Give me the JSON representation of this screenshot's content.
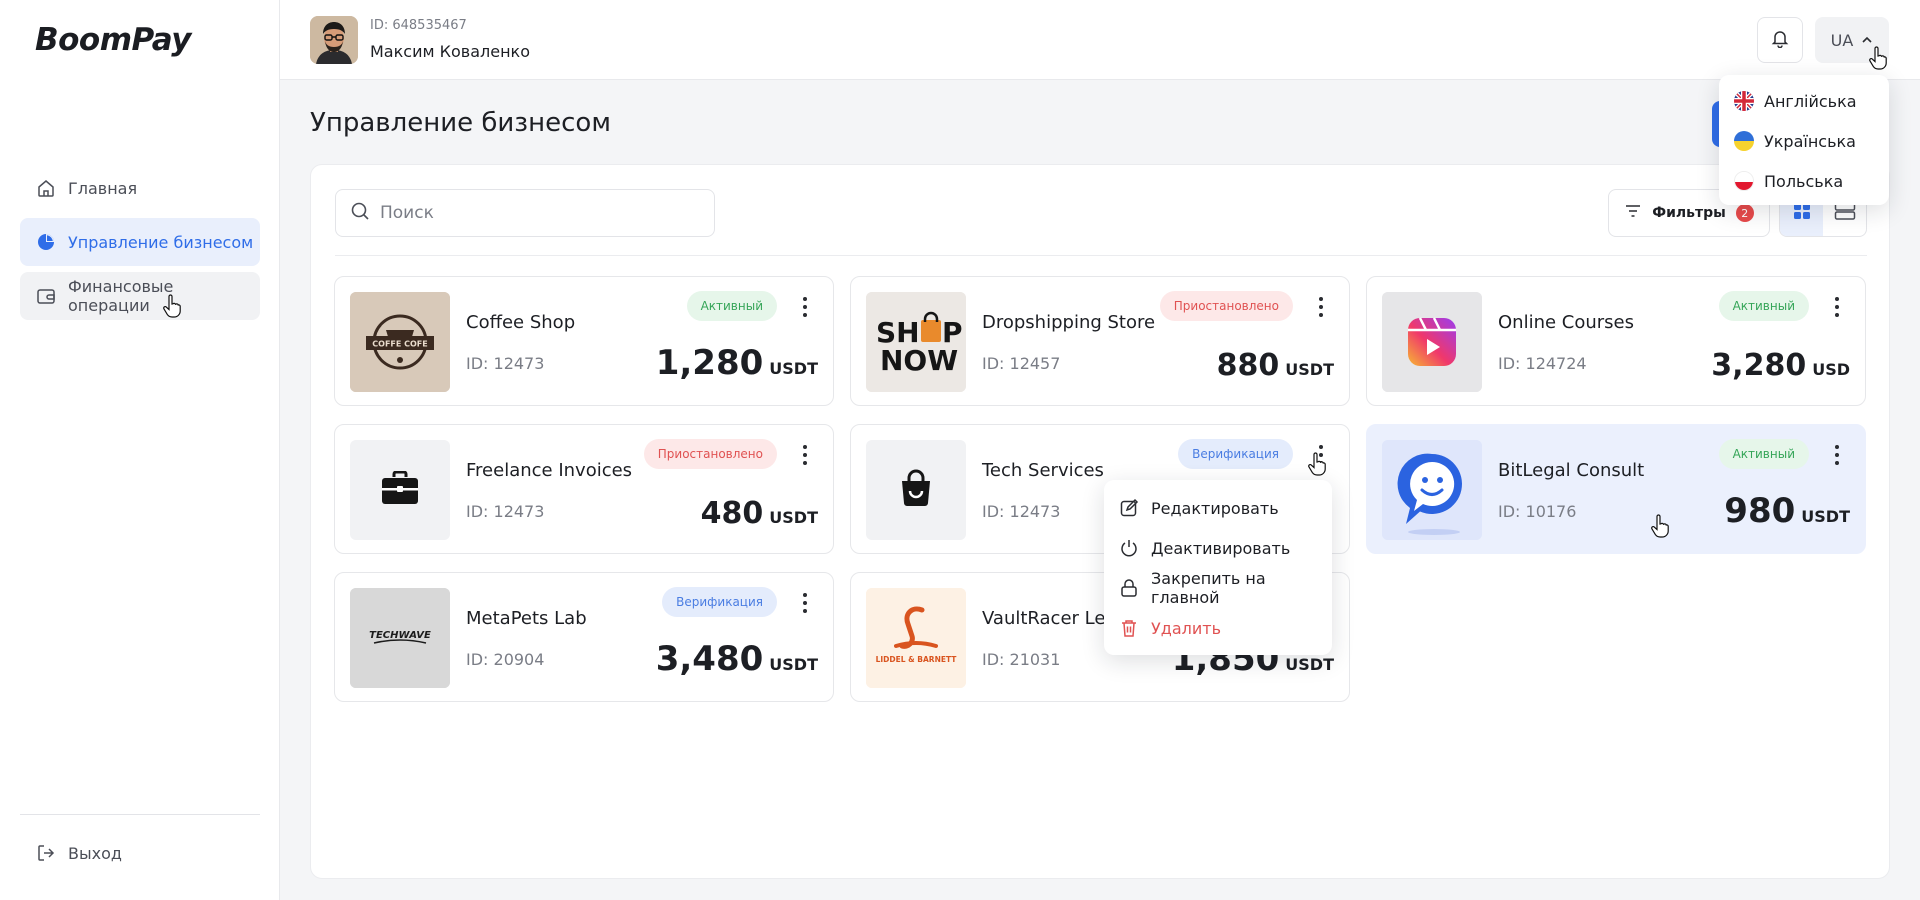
{
  "app": {
    "logo": "BoomPay"
  },
  "sidebar": {
    "items": [
      {
        "label": "Главная",
        "icon": "home-icon",
        "state": "default"
      },
      {
        "label": "Управление бизнесом",
        "icon": "pie-chart-icon",
        "state": "active"
      },
      {
        "label": "Финансовые операции",
        "icon": "wallet-icon",
        "state": "hover"
      }
    ],
    "logout_label": "Выход"
  },
  "header": {
    "user_id": "ID: 648535467",
    "user_name": "Максим Коваленко",
    "lang_current": "UA"
  },
  "language_menu": {
    "items": [
      {
        "label": "Англійська",
        "flag": "uk-flag"
      },
      {
        "label": "Українська",
        "flag": "ua-flag"
      },
      {
        "label": "Польська",
        "flag": "pl-flag"
      }
    ]
  },
  "page": {
    "title": "Управление бизнесом",
    "search_placeholder": "Поиск",
    "filters_label": "Фильтры",
    "filters_count": "2"
  },
  "businesses": [
    {
      "name": "Coffee Shop",
      "id": "ID: 12473",
      "status": "Активный",
      "status_type": "active",
      "amount": "1,280",
      "currency": "USDT",
      "logo": "coffee-cofe-logo"
    },
    {
      "name": "Dropshipping Store",
      "id": "ID: 12457",
      "status": "Приостановлено",
      "status_type": "paused",
      "amount": "880",
      "currency": "USDT",
      "logo": "shop-now-logo"
    },
    {
      "name": "Online Courses",
      "id": "ID: 124724",
      "status": "Активный",
      "status_type": "active",
      "amount": "3,280",
      "currency": "USD",
      "logo": "video-play-logo"
    },
    {
      "name": "Freelance Invoices",
      "id": "ID: 12473",
      "status": "Приостановлено",
      "status_type": "paused",
      "amount": "480",
      "currency": "USDT",
      "logo": "briefcase-icon"
    },
    {
      "name": "Tech Services",
      "id": "ID: 12473",
      "status": "Верификация",
      "status_type": "verify",
      "amount": "",
      "currency": "",
      "logo": "shopping-bag-icon"
    },
    {
      "name": "BitLegal Consult",
      "id": "ID: 10176",
      "status": "Активный",
      "status_type": "active",
      "amount": "980",
      "currency": "USDT",
      "logo": "chat-bubble-logo"
    },
    {
      "name": "MetaPets Lab",
      "id": "ID: 20904",
      "status": "Верификация",
      "status_type": "verify",
      "amount": "3,480",
      "currency": "USDT",
      "logo": "techwave-logo"
    },
    {
      "name": "VaultRacer Lea",
      "id": "ID: 21031",
      "status": "",
      "status_type": "",
      "amount": "1,850",
      "currency": "USDT",
      "logo": "liddel-barnett-logo"
    }
  ],
  "logo_texts": {
    "coffee": "COFFE COFE",
    "shop1": "SH",
    "shop2": "P",
    "shop3": "NOW",
    "techwave": "TECHWAVE",
    "liddel": "LIDDEL & BARNETT"
  },
  "context_menu": {
    "items": [
      {
        "label": "Редактировать",
        "icon": "edit-icon"
      },
      {
        "label": "Деактивировать",
        "icon": "power-icon"
      },
      {
        "label": "Закрепить на главной",
        "icon": "lock-icon"
      },
      {
        "label": "Удалить",
        "icon": "trash-icon"
      }
    ]
  },
  "colors": {
    "accent": "#2f6de8",
    "active": "#35a558",
    "paused": "#e05252",
    "verify": "#4a7de2"
  }
}
